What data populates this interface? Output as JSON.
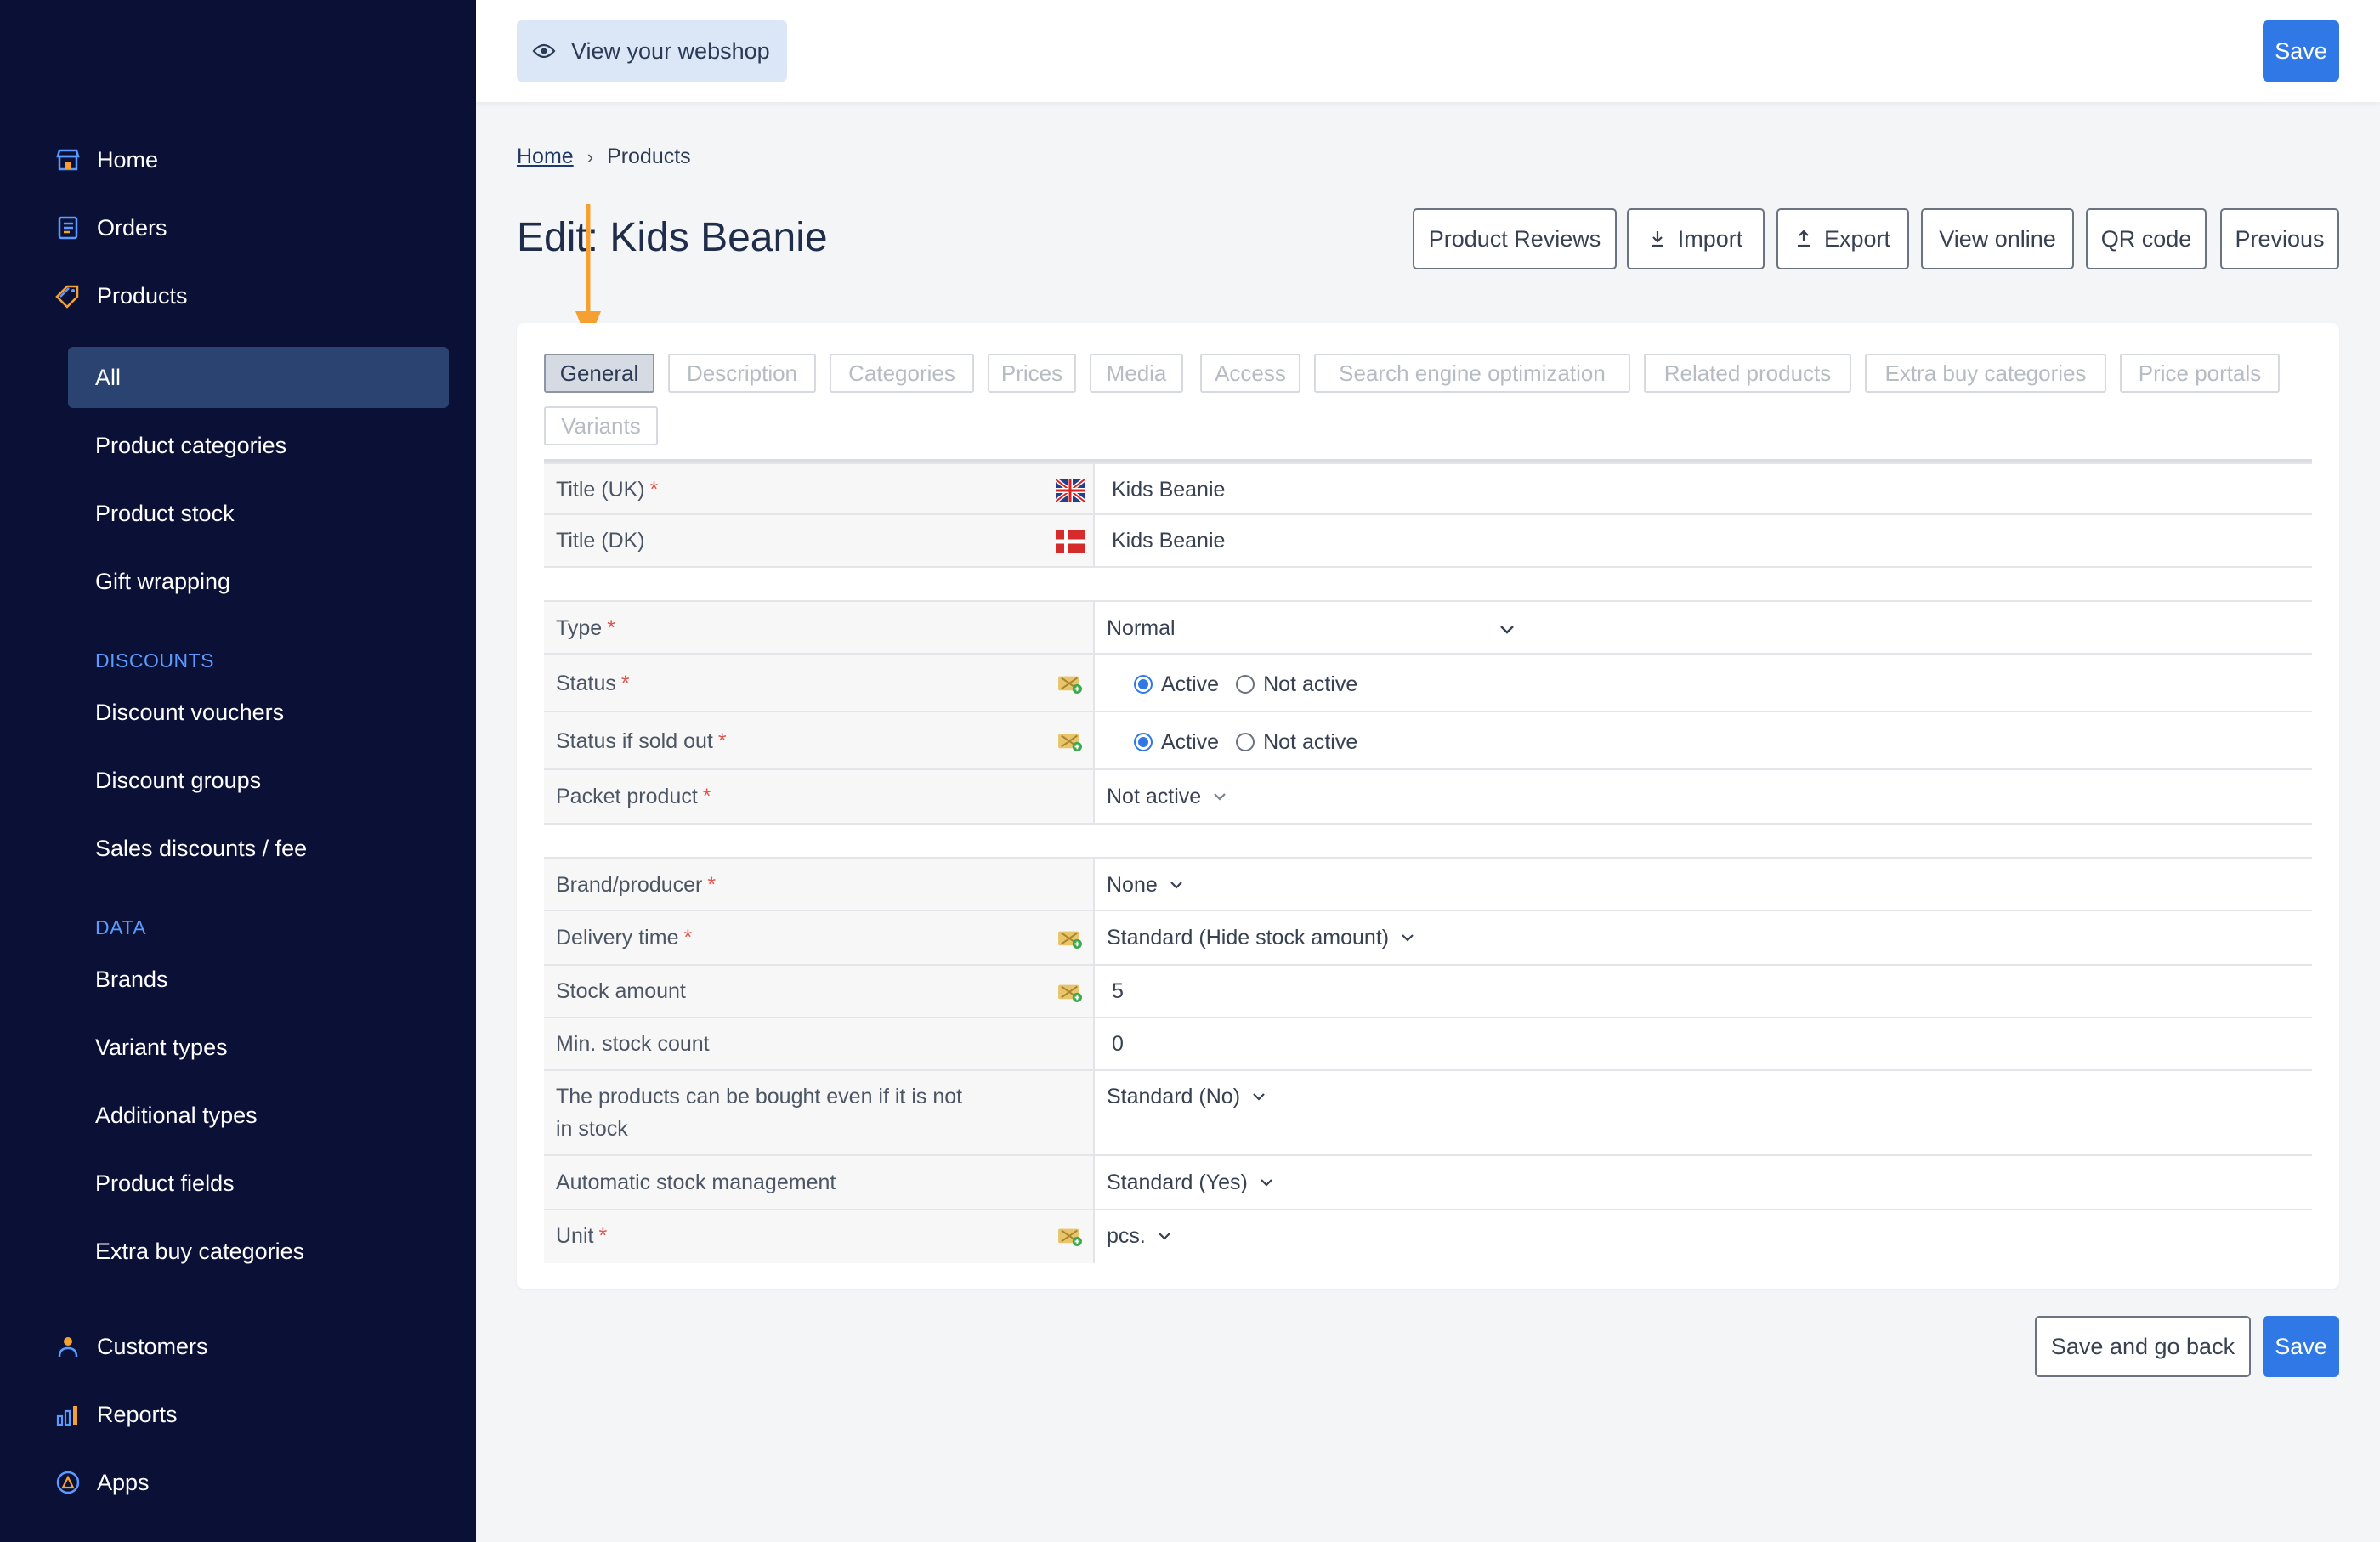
{
  "sidebar": {
    "main": [
      {
        "label": "Home",
        "icon": "store-icon"
      },
      {
        "label": "Orders",
        "icon": "orders-icon"
      },
      {
        "label": "Products",
        "icon": "tag-icon"
      }
    ],
    "products_sub": [
      "All",
      "Product categories",
      "Product stock",
      "Gift wrapping"
    ],
    "section_discounts": "DISCOUNTS",
    "discounts": [
      "Discount vouchers",
      "Discount groups",
      "Sales discounts / fee"
    ],
    "section_data": "DATA",
    "data": [
      "Brands",
      "Variant types",
      "Additional types",
      "Product fields",
      "Extra buy categories"
    ],
    "bottom": [
      {
        "label": "Customers",
        "icon": "person-icon"
      },
      {
        "label": "Reports",
        "icon": "bar-chart-icon"
      },
      {
        "label": "Apps",
        "icon": "apps-icon"
      }
    ],
    "active_item": "All"
  },
  "topbar": {
    "view_webshop": "View your webshop",
    "save": "Save"
  },
  "breadcrumb": {
    "home": "Home",
    "current": "Products"
  },
  "page": {
    "title": "Edit: Kids Beanie"
  },
  "actions": [
    "Product Reviews",
    "Import",
    "Export",
    "View online",
    "QR code",
    "Previous"
  ],
  "tabs": [
    "General",
    "Description",
    "Categories",
    "Prices",
    "Media",
    "Access",
    "Search engine optimization",
    "Related products",
    "Extra buy categories",
    "Price portals",
    "Variants"
  ],
  "active_tab": "General",
  "form": {
    "title_uk": {
      "label": "Title (UK)",
      "value": "Kids Beanie"
    },
    "title_dk": {
      "label": "Title (DK)",
      "value": "Kids Beanie"
    },
    "type": {
      "label": "Type",
      "value": "Normal"
    },
    "status": {
      "label": "Status",
      "opt_active": "Active",
      "opt_inactive": "Not active",
      "selected": "Active"
    },
    "status_sold_out": {
      "label": "Status if sold out",
      "opt_active": "Active",
      "opt_inactive": "Not active",
      "selected": "Active"
    },
    "packet_product": {
      "label": "Packet product",
      "value": "Not active"
    },
    "brand": {
      "label": "Brand/producer",
      "value": "None"
    },
    "delivery_time": {
      "label": "Delivery time",
      "value": "Standard (Hide stock amount)"
    },
    "stock_amount": {
      "label": "Stock amount",
      "value": "5"
    },
    "min_stock": {
      "label": "Min. stock count",
      "value": "0"
    },
    "buy_out_of_stock": {
      "label_line1": "The products can be bought even if it is not",
      "label_line2": "in stock",
      "value": "Standard (No)"
    },
    "auto_stock": {
      "label": "Automatic stock management",
      "value": "Standard (Yes)"
    },
    "unit": {
      "label": "Unit",
      "value": "pcs."
    },
    "required_mark": "*"
  },
  "footer": {
    "save_back": "Save and go back",
    "save": "Save"
  },
  "colors": {
    "sidebar_bg": "#0b1036",
    "primary": "#2f78e6",
    "accent_arrow": "#f5a030",
    "required": "#e2564f"
  }
}
